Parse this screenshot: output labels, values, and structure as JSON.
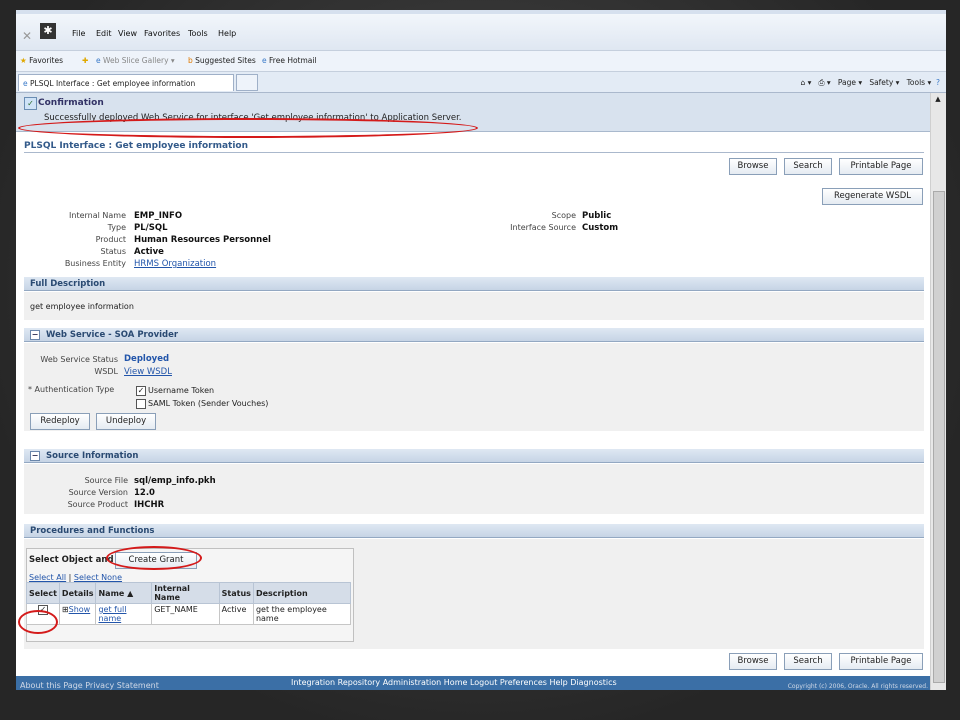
{
  "browser": {
    "menu": [
      "File",
      "Edit",
      "View",
      "Favorites",
      "Tools",
      "Help"
    ],
    "favorites_label": "Favorites",
    "favorites_items": [
      "Web Slice Gallery ▾",
      "Suggested Sites",
      "Free Hotmail"
    ],
    "tab_title": "PLSQL Interface : Get employee information",
    "toolbar_items": [
      "Page ▾",
      "Safety ▾",
      "Tools ▾"
    ]
  },
  "confirmation": {
    "title": "Confirmation",
    "message": "Successfully deployed Web Service for interface 'Get employee information' to Application Server."
  },
  "page": {
    "title": "PLSQL Interface : Get employee information",
    "buttons": {
      "browse": "Browse",
      "search": "Search",
      "printable": "Printable Page",
      "regenerate": "Regenerate WSDL"
    }
  },
  "details": {
    "internal_name_label": "Internal Name",
    "internal_name": "EMP_INFO",
    "type_label": "Type",
    "type": "PL/SQL",
    "product_label": "Product",
    "product": "Human Resources Personnel",
    "status_label": "Status",
    "status": "Active",
    "business_entity_label": "Business Entity",
    "business_entity": "HRMS Organization",
    "scope_label": "Scope",
    "scope": "Public",
    "interface_source_label": "Interface Source",
    "interface_source": "Custom"
  },
  "full_description": {
    "header": "Full Description",
    "text": "get employee information"
  },
  "web_service": {
    "header": "Web Service - SOA Provider",
    "status_label": "Web Service Status",
    "status": "Deployed",
    "wsdl_label": "WSDL",
    "wsdl": "View WSDL",
    "auth_label": "* Authentication Type",
    "auth_option1": "Username Token",
    "auth_option2": "SAML Token (Sender Vouches)",
    "redeploy": "Redeploy",
    "undeploy": "Undeploy"
  },
  "source_info": {
    "header": "Source Information",
    "file_label": "Source File",
    "file": "sql/emp_info.pkh",
    "version_label": "Source Version",
    "version": "12.0",
    "product_label": "Source Product",
    "product": "IHCHR"
  },
  "procedures": {
    "header": "Procedures and Functions",
    "select_object_label": "Select Object and",
    "create_grant": "Create Grant",
    "select_all": "Select All",
    "select_none": "Select None",
    "columns": [
      "Select",
      "Details",
      "Name ▲",
      "Internal Name",
      "Status",
      "Description"
    ],
    "row": {
      "details": "Show",
      "name": "get full name",
      "internal_name": "GET_NAME",
      "status": "Active",
      "description": "get the employee name"
    }
  },
  "footer": {
    "links": "Integration Repository   Administration   Home   Logout   Preferences   Help   Diagnostics",
    "about": "About this Page     Privacy Statement",
    "copyright": "Copyright (c) 2006, Oracle. All rights reserved."
  }
}
